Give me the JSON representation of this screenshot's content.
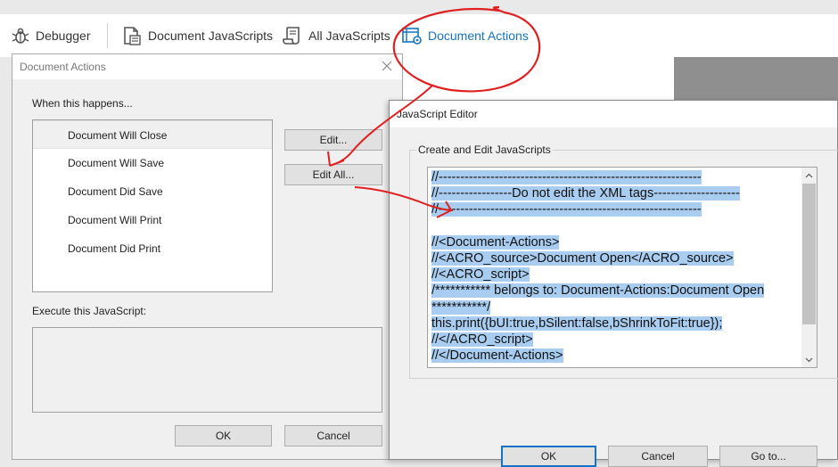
{
  "toolbar": {
    "items": [
      {
        "label": "Debugger",
        "icon": "bug-icon"
      },
      {
        "label": "Document JavaScripts",
        "icon": "document-script-icon"
      },
      {
        "label": "All JavaScripts",
        "icon": "scroll-script-icon"
      },
      {
        "label": "Document Actions",
        "icon": "document-gear-icon"
      }
    ],
    "active_color": "#1473c4"
  },
  "document_actions": {
    "title": "Document Actions",
    "when_label": "When this happens...",
    "events": [
      "Document Will Close",
      "Document Will Save",
      "Document Did Save",
      "Document Will Print",
      "Document Did Print"
    ],
    "selected_index": 0,
    "edit_label": "Edit...",
    "edit_all_label": "Edit All...",
    "execute_label": "Execute this JavaScript:",
    "ok_label": "OK",
    "cancel_label": "Cancel"
  },
  "js_editor": {
    "title": "JavaScript Editor",
    "group_label": "Create and Edit JavaScripts",
    "code_lines": [
      "//-------------------------------------------------------------",
      "//-----------------Do not edit the XML tags--------------------",
      "//-------------------------------------------------------------",
      "",
      "//<Document-Actions>",
      "//<ACRO_source>Document Open</ACRO_source>",
      "//<ACRO_script>",
      "/*********** belongs to: Document-Actions:Document Open",
      "***********/",
      "this.print({bUI:true,bSilent:false,bShrinkToFit:true});",
      "//</ACRO_script>",
      "//</Document-Actions>"
    ],
    "ok_label": "OK",
    "cancel_label": "Cancel",
    "goto_label": "Go to...",
    "selection_color": "#a8cdf0"
  },
  "annotation_color": "#e02020"
}
